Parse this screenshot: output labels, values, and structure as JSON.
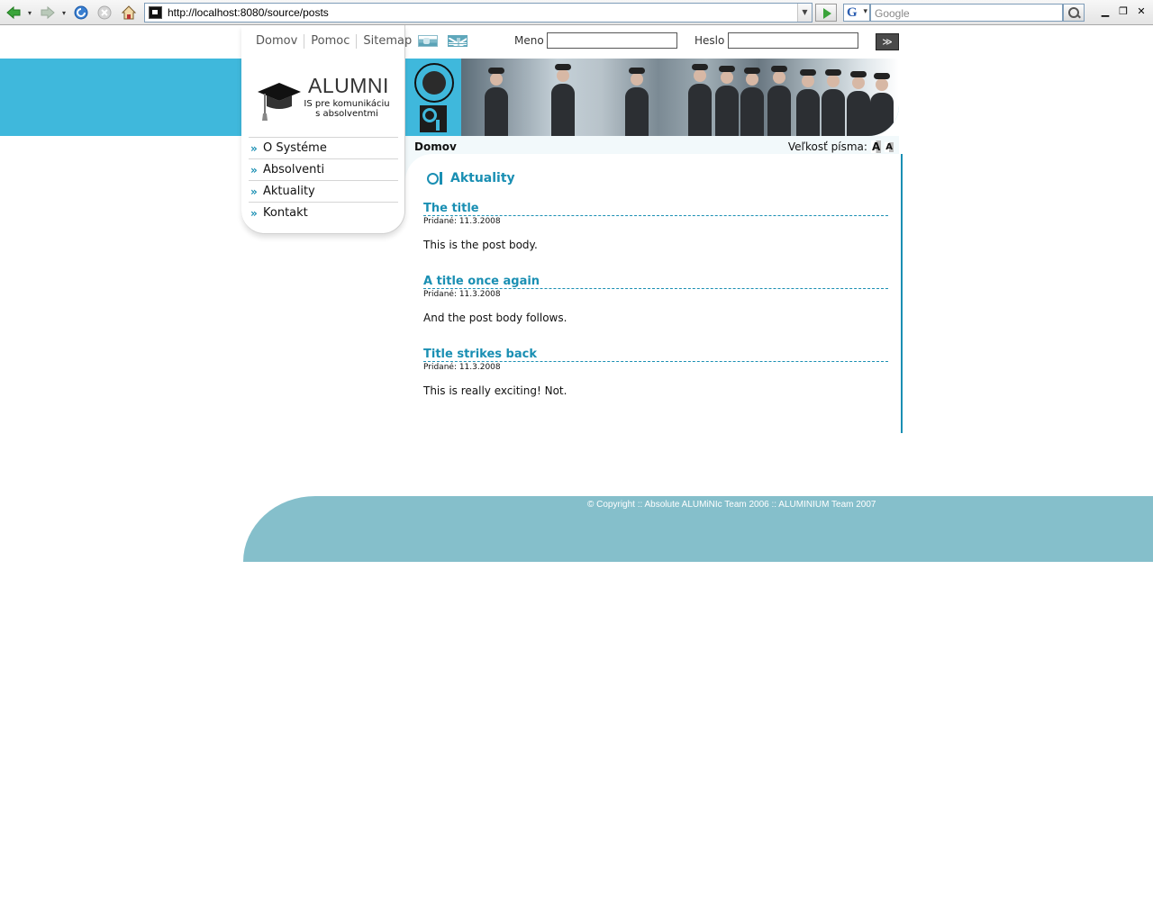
{
  "browser": {
    "url": "http://localhost:8080/source/posts",
    "search_placeholder": "Google",
    "search_engine_letter": "G"
  },
  "header": {
    "top_links": [
      "Domov",
      "Pomoc",
      "Sitemap"
    ],
    "logo_title": "ALUMNI",
    "logo_subtitle_line1": "IS pre komunikáciu",
    "logo_subtitle_line2": "s absolventmi",
    "login_name_label": "Meno",
    "login_password_label": "Heslo",
    "login_button": "≫",
    "languages": [
      "sk-flag",
      "uk-flag"
    ]
  },
  "sidebar": {
    "items": [
      {
        "label": "O Systéme"
      },
      {
        "label": "Absolventi"
      },
      {
        "label": "Aktuality"
      },
      {
        "label": "Kontakt"
      }
    ]
  },
  "breadcrumb": {
    "current": "Domov",
    "font_size_label": "Veľkosť písma:",
    "font_big": "A",
    "font_small": "A"
  },
  "main": {
    "section_title": "Aktuality",
    "posts": [
      {
        "title": "The title",
        "date": "Pridané: 11.3.2008",
        "body": "This is the post body."
      },
      {
        "title": "A title once again",
        "date": "Pridané: 11.3.2008",
        "body": "And the post body follows."
      },
      {
        "title": "Title strikes back",
        "date": "Pridané: 11.3.2008",
        "body": "This is really exciting! Not."
      }
    ]
  },
  "footer": {
    "copyright": "© Copyright :: Absolute ALUMiNIc Team 2006 :: ALUMINIUM Team 2007"
  },
  "colors": {
    "accent": "#1a8fb3",
    "banner": "#3fb8dc",
    "footer": "#85bfcb"
  }
}
